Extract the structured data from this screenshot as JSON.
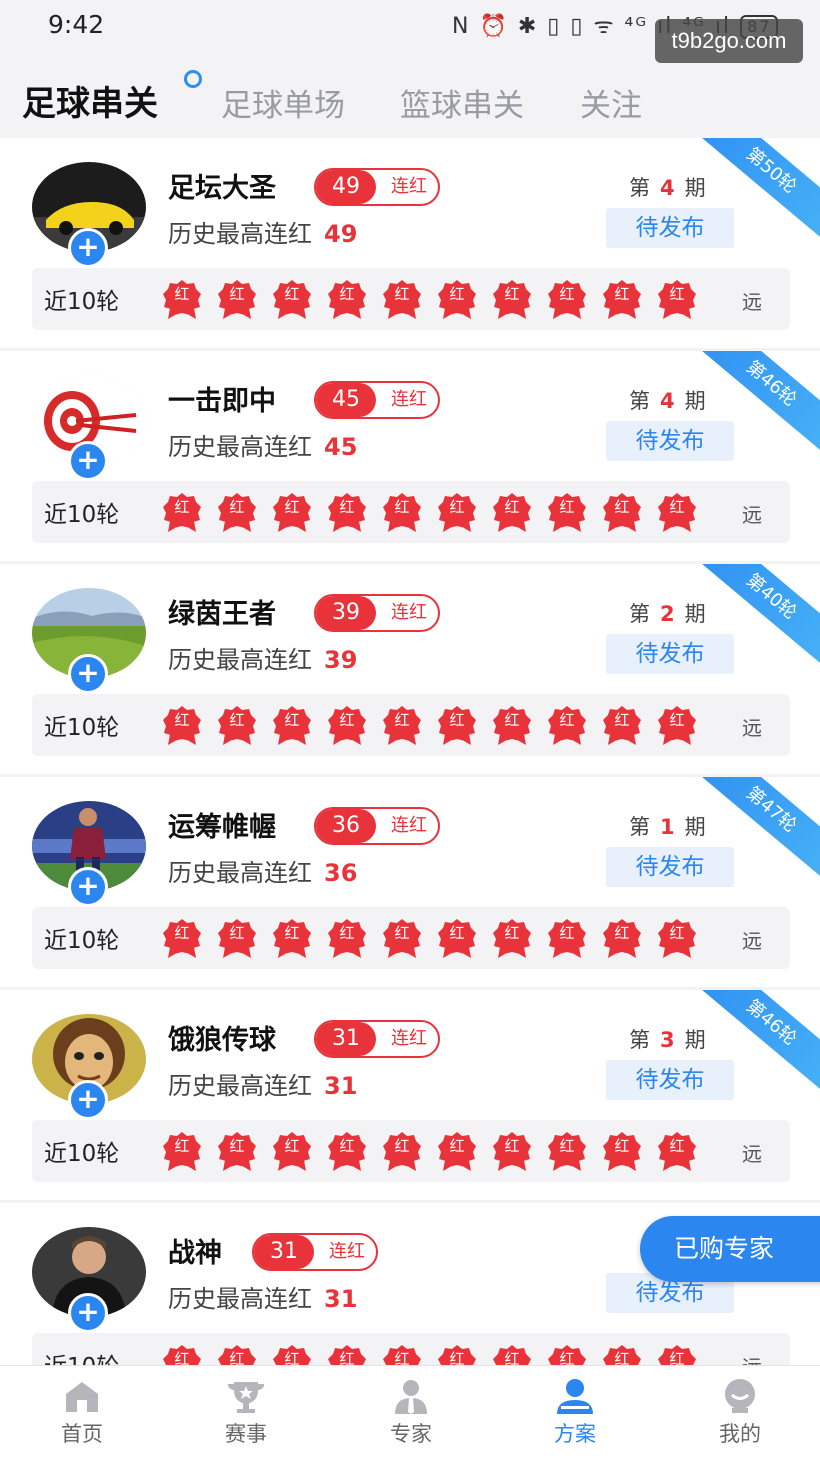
{
  "status_bar": {
    "time": "9:42",
    "icons_text": "N ⏰ ✱ ▯ ▯ ᯤ ⁴ᴳ ıl ⁴ᴳ ıl",
    "battery": "87"
  },
  "watermark": "t9b2go.com",
  "tabs": [
    {
      "label": "足球串关",
      "active": true
    },
    {
      "label": "足球单场",
      "active": false
    },
    {
      "label": "篮球串关",
      "active": false
    },
    {
      "label": "关注",
      "active": false
    }
  ],
  "card_text": {
    "streak_label": "连红",
    "history_label": "历史最高连红",
    "period_prefix": "第",
    "period_suffix": "期",
    "pending_label": "待发布",
    "recent_label": "近10轮",
    "badge_text": "红",
    "far_label": "远"
  },
  "experts": [
    {
      "name": "足坛大圣",
      "streak": "49",
      "history_max": "49",
      "period": "4",
      "round": "第50轮",
      "avatar": "car-avatar",
      "recent": [
        "红",
        "红",
        "红",
        "红",
        "红",
        "红",
        "红",
        "红",
        "红",
        "红"
      ]
    },
    {
      "name": "一击即中",
      "streak": "45",
      "history_max": "45",
      "period": "4",
      "round": "第46轮",
      "avatar": "target-avatar",
      "recent": [
        "红",
        "红",
        "红",
        "红",
        "红",
        "红",
        "红",
        "红",
        "红",
        "红"
      ]
    },
    {
      "name": "绿茵王者",
      "streak": "39",
      "history_max": "39",
      "period": "2",
      "round": "第40轮",
      "avatar": "grassland-avatar",
      "recent": [
        "红",
        "红",
        "红",
        "红",
        "红",
        "红",
        "红",
        "红",
        "红",
        "红"
      ]
    },
    {
      "name": "运筹帷幄",
      "streak": "36",
      "history_max": "36",
      "period": "1",
      "round": "第47轮",
      "avatar": "footballer-avatar",
      "recent": [
        "红",
        "红",
        "红",
        "红",
        "红",
        "红",
        "红",
        "红",
        "红",
        "红"
      ]
    },
    {
      "name": "饿狼传球",
      "streak": "31",
      "history_max": "31",
      "period": "3",
      "round": "第46轮",
      "avatar": "cartoon-avatar",
      "recent": [
        "红",
        "红",
        "红",
        "红",
        "红",
        "红",
        "红",
        "红",
        "红",
        "红"
      ]
    },
    {
      "name": "战神",
      "streak": "31",
      "history_max": "31",
      "period": "",
      "round": "",
      "avatar": "man-avatar",
      "recent": [
        "红",
        "红",
        "红",
        "红",
        "红",
        "红",
        "红",
        "红",
        "红",
        "红"
      ]
    }
  ],
  "floating_button": "已购专家",
  "bottom_nav": [
    {
      "label": "首页",
      "icon": "home-icon",
      "active": false
    },
    {
      "label": "赛事",
      "icon": "trophy-icon",
      "active": false
    },
    {
      "label": "专家",
      "icon": "expert-icon",
      "active": false
    },
    {
      "label": "方案",
      "icon": "plan-icon",
      "active": true
    },
    {
      "label": "我的",
      "icon": "profile-icon",
      "active": false
    }
  ],
  "colors": {
    "accent_blue": "#2b86f0",
    "red": "#e8333a",
    "background": "#f3f3f6"
  }
}
